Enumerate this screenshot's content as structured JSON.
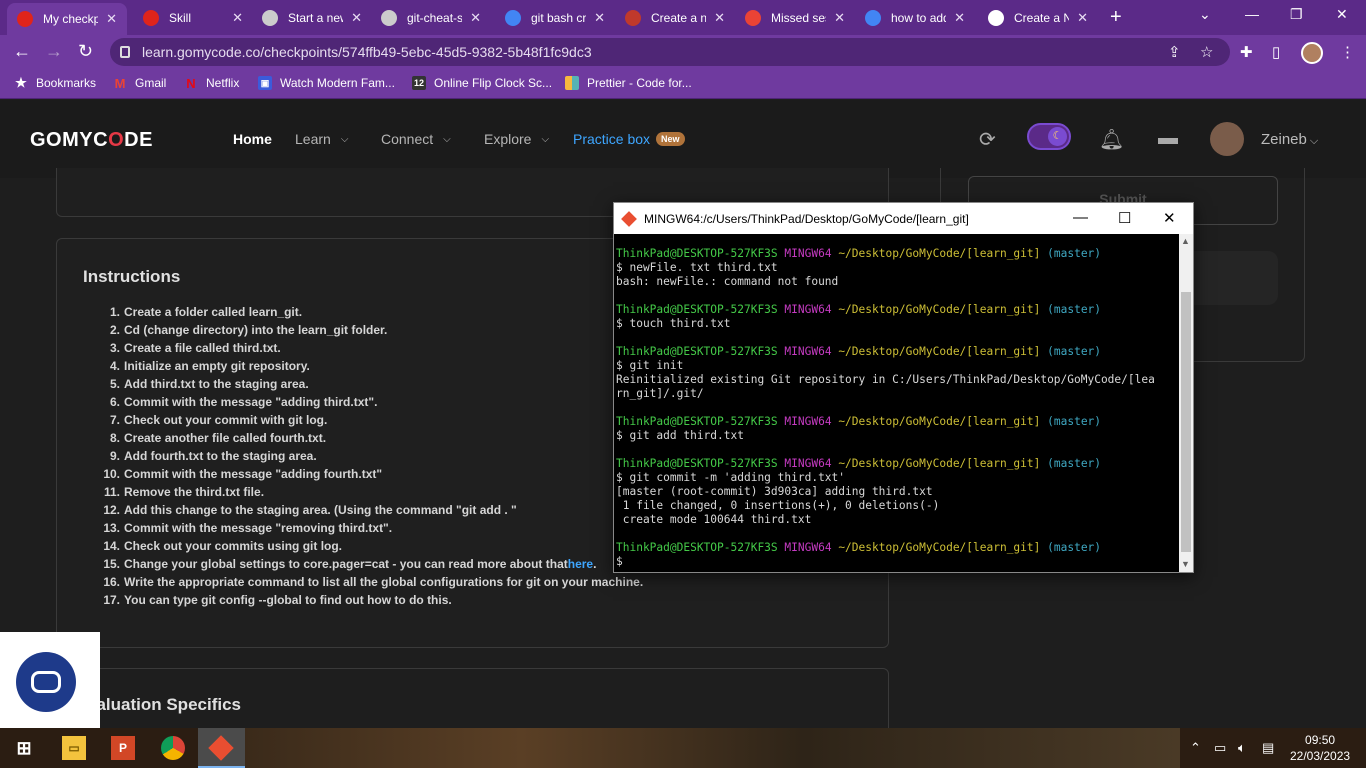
{
  "browser": {
    "tabs": [
      {
        "title": "My checkp",
        "icon": "opera-icon",
        "color": "#e0241b"
      },
      {
        "title": "Skill",
        "icon": "opera-icon",
        "color": "#e0241b"
      },
      {
        "title": "Start a new",
        "icon": "page-icon",
        "color": "#cccccc"
      },
      {
        "title": "git-cheat-s",
        "icon": "globe-icon",
        "color": "#cccccc"
      },
      {
        "title": "git bash cr",
        "icon": "google-icon",
        "color": "#4285f4"
      },
      {
        "title": "Create a ne",
        "icon": "dev-icon",
        "color": "#c0392b"
      },
      {
        "title": "Missed ses",
        "icon": "gmail-icon",
        "color": "#ea4335"
      },
      {
        "title": "how to add",
        "icon": "google-icon",
        "color": "#4285f4"
      },
      {
        "title": "Create a N",
        "icon": "github-icon",
        "color": "#ffffff"
      }
    ],
    "url": "learn.gomycode.co/checkpoints/574ffb49-5ebc-45d5-9382-5b48f1fc9dc3",
    "bookmarks": [
      {
        "label": "Bookmarks",
        "icon": "star-icon"
      },
      {
        "label": "Gmail",
        "icon": "gmail-icon"
      },
      {
        "label": "Netflix",
        "icon": "netflix-icon"
      },
      {
        "label": "Watch Modern Fam...",
        "icon": "tv-icon"
      },
      {
        "label": "Online Flip Clock Sc...",
        "icon": "clock-icon"
      },
      {
        "label": "Prettier - Code for...",
        "icon": "prettier-icon"
      }
    ]
  },
  "header": {
    "logo": {
      "prefix": "GOMYC",
      "o": "O",
      "suffix": "DE"
    },
    "nav": {
      "home": "Home",
      "learn": "Learn",
      "connect": "Connect",
      "explore": "Explore",
      "practice": "Practice box",
      "practice_badge": "New"
    },
    "user": "Zeineb"
  },
  "page": {
    "submit_label": "Submit",
    "instructions_title": "Instructions",
    "instructions": [
      {
        "n": "1.",
        "text": "Create a folder called learn_git."
      },
      {
        "n": "2.",
        "text": "Cd (change directory) into the learn_git folder."
      },
      {
        "n": "3.",
        "text": "Create a file called third.txt."
      },
      {
        "n": "4.",
        "text": "Initialize an empty git repository."
      },
      {
        "n": "5.",
        "text": "Add third.txt to the staging area."
      },
      {
        "n": "6.",
        "text": "Commit with the message \"adding third.txt\"."
      },
      {
        "n": "7.",
        "text": "Check out your commit with git log."
      },
      {
        "n": "8.",
        "text": "Create another file called fourth.txt."
      },
      {
        "n": "9.",
        "text": "Add fourth.txt to the staging area."
      },
      {
        "n": "10.",
        "text": "Commit with the message \"adding fourth.txt\""
      },
      {
        "n": "11.",
        "text": "Remove the third.txt file."
      },
      {
        "n": "12.",
        "text": "Add this change to the staging area. (Using the command \"git add . \""
      },
      {
        "n": "13.",
        "text": "Commit with the message \"removing third.txt\"."
      },
      {
        "n": "14.",
        "text": "Check out your commits using git log."
      },
      {
        "n": "15.",
        "text": "Change your global settings to core.pager=cat - you can read more about that ",
        "link": "here",
        "after": "."
      },
      {
        "n": "16.",
        "text": "Write the appropriate command to list all the global configurations for git on your machine."
      },
      {
        "n": "17.",
        "text": "You can type git config --global to find out how to do this."
      }
    ],
    "evaluation_title": "valuation Specifics"
  },
  "terminal": {
    "title": "MINGW64:/c/Users/ThinkPad/Desktop/GoMyCode/[learn_git]",
    "prompt_user": "ThinkPad@DESKTOP-527KF3S",
    "prompt_env": "MINGW64",
    "prompt_path": "~/Desktop/GoMyCode/[learn_git]",
    "prompt_branch": "(master)",
    "lines": [
      {
        "type": "prompt"
      },
      {
        "type": "text",
        "text": "$ newFile. txt third.txt"
      },
      {
        "type": "text",
        "text": "bash: newFile.: command not found"
      },
      {
        "type": "blank"
      },
      {
        "type": "prompt"
      },
      {
        "type": "text",
        "text": "$ touch third.txt"
      },
      {
        "type": "blank"
      },
      {
        "type": "prompt"
      },
      {
        "type": "text",
        "text": "$ git init"
      },
      {
        "type": "text",
        "text": "Reinitialized existing Git repository in C:/Users/ThinkPad/Desktop/GoMyCode/[lea"
      },
      {
        "type": "text",
        "text": "rn_git]/.git/"
      },
      {
        "type": "blank"
      },
      {
        "type": "prompt"
      },
      {
        "type": "text",
        "text": "$ git add third.txt"
      },
      {
        "type": "blank"
      },
      {
        "type": "prompt"
      },
      {
        "type": "text",
        "text": "$ git commit -m 'adding third.txt'"
      },
      {
        "type": "text",
        "text": "[master (root-commit) 3d903ca] adding third.txt"
      },
      {
        "type": "text",
        "text": " 1 file changed, 0 insertions(+), 0 deletions(-)"
      },
      {
        "type": "text",
        "text": " create mode 100644 third.txt"
      },
      {
        "type": "blank"
      },
      {
        "type": "prompt"
      },
      {
        "type": "text",
        "text": "$"
      }
    ]
  },
  "taskbar": {
    "time": "09:50",
    "date": "22/03/2023"
  },
  "colors": {
    "browser_purple": "#6f3a9f",
    "terminal_green": "#44c948",
    "terminal_purple": "#c53bc2",
    "terminal_yellow": "#cdbf36",
    "terminal_cyan": "#3fa8c2",
    "link_blue": "#3ea6ff"
  }
}
